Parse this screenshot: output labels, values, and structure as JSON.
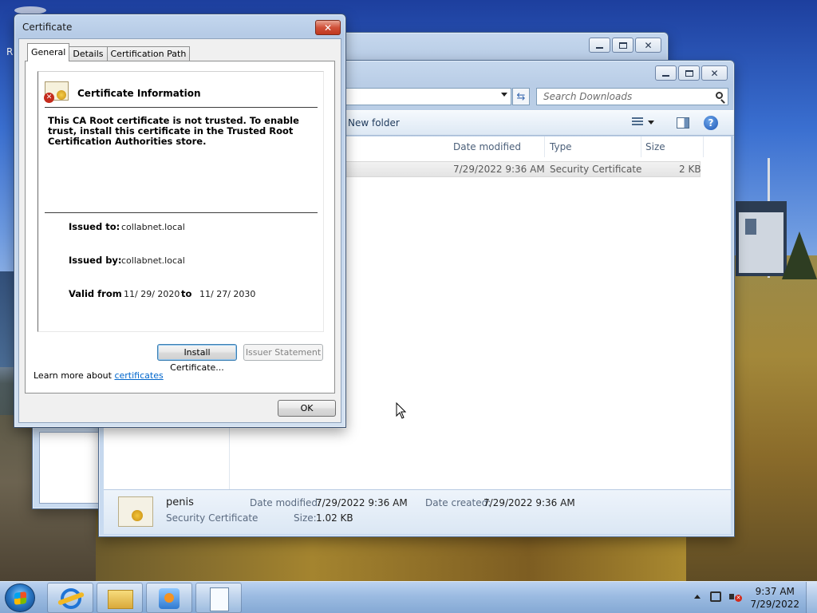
{
  "desktop": {
    "edge_letter": "R"
  },
  "explorer": {
    "search_placeholder": "Search Downloads",
    "new_folder": "New folder",
    "help_glyph": "?",
    "columns": [
      "Date modified",
      "Type",
      "Size"
    ],
    "file": {
      "date_modified": "7/29/2022 9:36 AM",
      "type": "Security Certificate",
      "size": "2 KB"
    },
    "details": {
      "name": "penis",
      "kind": "Security Certificate",
      "date_modified_label": "Date modified:",
      "date_modified": "7/29/2022 9:36 AM",
      "date_created_label": "Date created:",
      "date_created": "7/29/2022 9:36 AM",
      "size_label": "Size:",
      "size": "1.02 KB"
    }
  },
  "certificate": {
    "title": "Certificate",
    "tabs": [
      "General",
      "Details",
      "Certification Path"
    ],
    "info_title": "Certificate Information",
    "warning": "This CA Root certificate is not trusted. To enable trust, install this certificate in the Trusted Root Certification Authorities store.",
    "issued_to_label": "Issued to:",
    "issued_to": "collabnet.local",
    "issued_by_label": "Issued by:",
    "issued_by": "collabnet.local",
    "valid_from_label": "Valid from",
    "valid_from": "11/ 29/ 2020",
    "to_label": "to",
    "valid_to": "11/ 27/ 2030",
    "install_button": "Install Certificate...",
    "issuer_statement_button": "Issuer Statement",
    "learn_more_prefix": "Learn more about ",
    "learn_more_link": "certificates",
    "ok_button": "OK"
  },
  "taskbar": {
    "clock_time": "9:37 AM",
    "clock_date": "7/29/2022"
  },
  "colors": {
    "link": "#0066cc",
    "close_red": "#c0381e",
    "taskbar": "#a5c3e6"
  }
}
